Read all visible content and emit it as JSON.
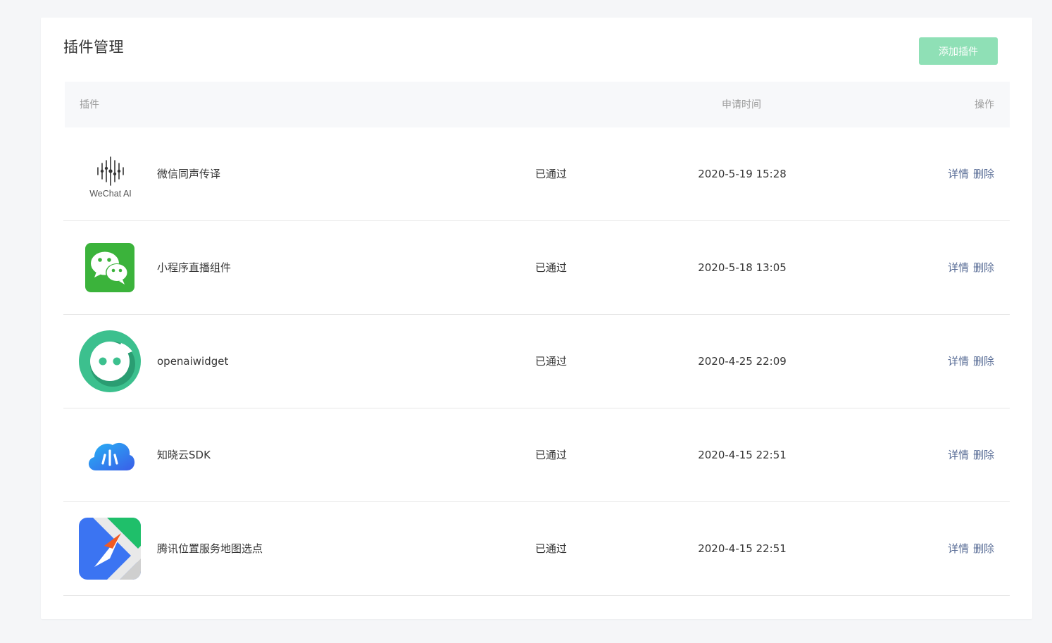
{
  "page": {
    "title": "插件管理",
    "add_button": "添加插件"
  },
  "table": {
    "headers": {
      "plugin": "插件",
      "time": "申请时间",
      "operation": "操作"
    },
    "rows": [
      {
        "icon": "wechat-ai-logo-icon",
        "logo_text": "WeChat AI",
        "name": "微信同声传译",
        "status": "已通过",
        "time": "2020-5-19 15:28",
        "detail": "详情",
        "delete": "删除"
      },
      {
        "icon": "wechat-logo-icon",
        "name": "小程序直播组件",
        "status": "已通过",
        "time": "2020-5-18 13:05",
        "detail": "详情",
        "delete": "删除"
      },
      {
        "icon": "openaiwidget-logo-icon",
        "name": "openaiwidget",
        "status": "已通过",
        "time": "2020-4-25 22:09",
        "detail": "详情",
        "delete": "删除"
      },
      {
        "icon": "zhixiao-cloud-logo-icon",
        "name": "知晓云SDK",
        "status": "已通过",
        "time": "2020-4-15 22:51",
        "detail": "详情",
        "delete": "删除"
      },
      {
        "icon": "tencent-map-logo-icon",
        "name": "腾讯位置服务地图选点",
        "status": "已通过",
        "time": "2020-4-15 22:51",
        "detail": "详情",
        "delete": "删除"
      }
    ]
  },
  "colors": {
    "accent_disabled": "#8fe0b6",
    "link": "#576b95",
    "wechat_green": "#3bb33b",
    "openai_green": "#3cc08e",
    "cloud_blue": "#3d8ef5",
    "map_blue": "#3b74f2"
  }
}
